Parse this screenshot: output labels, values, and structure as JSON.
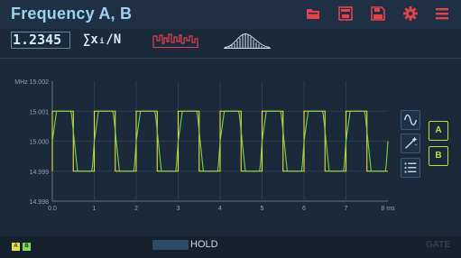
{
  "header": {
    "title": "Frequency A, B"
  },
  "toolbar": {
    "icons": [
      "folder-icon",
      "save-session-icon",
      "save-icon",
      "gear-icon",
      "menu-icon"
    ],
    "accent": "#e2424b"
  },
  "modes": {
    "main_value": "1.2345",
    "sum_label": "∑xᵢ/N"
  },
  "chart_data": {
    "type": "line",
    "x_unit": "ms",
    "y_unit": "MHz",
    "xlim": [
      0,
      8
    ],
    "ylim": [
      14.998,
      15.002
    ],
    "x_ticks": [
      "0.0",
      "1",
      "2",
      "3",
      "4",
      "5",
      "6",
      "7",
      "8 ms"
    ],
    "y_ticks": [
      "15.002",
      "15.001",
      "15.000",
      "14.999",
      "14.998"
    ],
    "series": [
      {
        "shape": "square",
        "color": "#e6e23a",
        "high": 15.001,
        "low": 14.999,
        "period_ms": 1.0,
        "high_start_ms": 0.0,
        "high_duration_ms": 0.5
      },
      {
        "shape": "smooth",
        "color": "#7ed348",
        "high": 15.001,
        "low": 14.999,
        "period_ms": 1.0,
        "phase_ms": 0.0
      }
    ]
  },
  "side_tools": {
    "icons": [
      "sine-wave-icon",
      "magic-wand-icon",
      "list-icon"
    ]
  },
  "channels": {
    "a_label": "A",
    "b_label": "B",
    "a_color": "#e8e039",
    "b_color": "#7de04a"
  },
  "status": {
    "hold_label": "HOLD",
    "gate_label": "GATE"
  }
}
